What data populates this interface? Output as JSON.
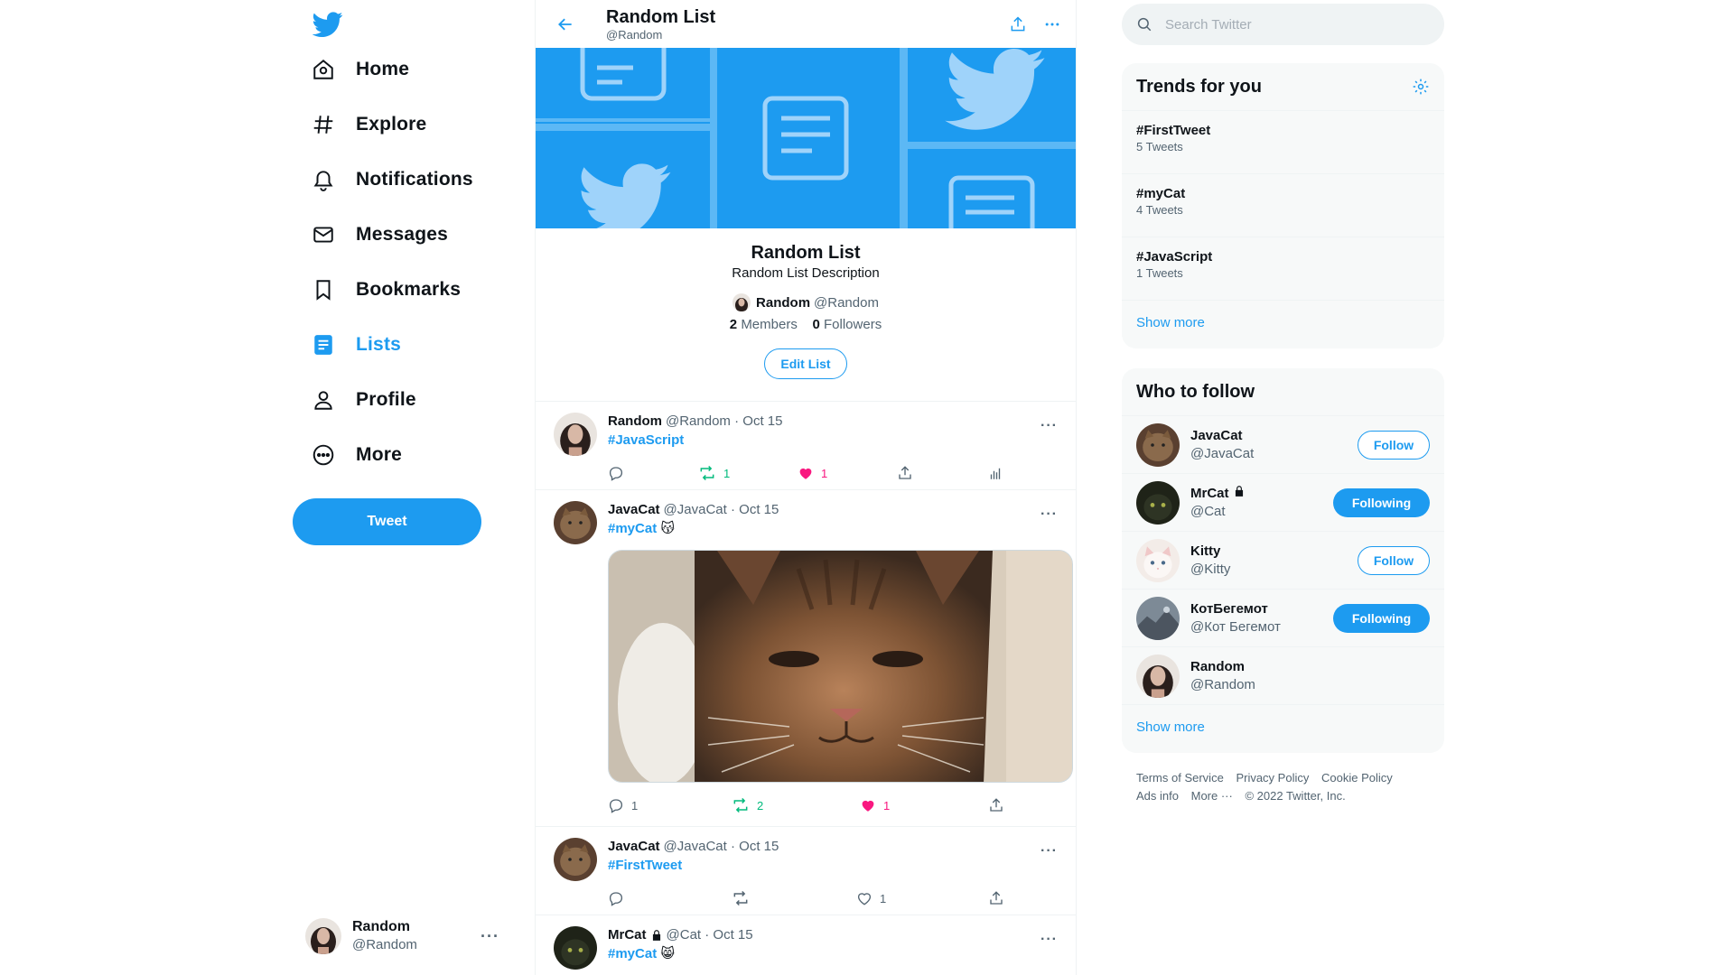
{
  "colors": {
    "accent": "#1d9bf0",
    "like": "#f91880",
    "retweet": "#00ba7c",
    "text": "#0f1419",
    "muted": "#536471"
  },
  "nav": {
    "items": [
      {
        "label": "Home",
        "icon": "home-icon"
      },
      {
        "label": "Explore",
        "icon": "hashtag-icon"
      },
      {
        "label": "Notifications",
        "icon": "bell-icon"
      },
      {
        "label": "Messages",
        "icon": "envelope-icon"
      },
      {
        "label": "Bookmarks",
        "icon": "bookmark-icon"
      },
      {
        "label": "Lists",
        "icon": "list-icon",
        "active": true
      },
      {
        "label": "Profile",
        "icon": "user-icon"
      },
      {
        "label": "More",
        "icon": "more-circle-icon"
      }
    ],
    "tweet_button": "Tweet"
  },
  "account": {
    "name": "Random",
    "handle": "@Random",
    "dots": "···"
  },
  "header": {
    "title": "Random List",
    "handle": "@Random"
  },
  "list": {
    "name": "Random List",
    "description": "Random List Description",
    "owner_name": "Random",
    "owner_handle": "@Random",
    "members_count": "2",
    "members_label": "Members",
    "followers_count": "0",
    "followers_label": "Followers",
    "edit_button": "Edit List"
  },
  "tweets": [
    {
      "name": "Random",
      "handle": "@Random",
      "date": "· Oct 15",
      "hashtag": "#JavaScript",
      "emoji": "",
      "replies": "",
      "retweets": "1",
      "likes": "1",
      "liked": true,
      "retweeted": true,
      "locked": false,
      "has_media": false
    },
    {
      "name": "JavaCat",
      "handle": "@JavaCat",
      "date": "· Oct 15",
      "hashtag": "#myCat",
      "emoji": "😽",
      "replies": "1",
      "retweets": "2",
      "likes": "1",
      "liked": true,
      "retweeted": true,
      "locked": false,
      "has_media": true
    },
    {
      "name": "JavaCat",
      "handle": "@JavaCat",
      "date": "· Oct 15",
      "hashtag": "#FirstTweet",
      "emoji": "",
      "replies": "",
      "retweets": "",
      "likes": "1",
      "liked": false,
      "retweeted": false,
      "locked": false,
      "has_media": false
    },
    {
      "name": "MrCat",
      "handle": "@Cat",
      "date": "· Oct 15",
      "hashtag": "#myCat",
      "emoji": "😸",
      "replies": "",
      "retweets": "",
      "likes": "",
      "liked": false,
      "retweeted": false,
      "locked": true,
      "has_media": false
    }
  ],
  "search": {
    "placeholder": "Search Twitter",
    "value": ""
  },
  "trends": {
    "title": "Trends for you",
    "items": [
      {
        "tag": "#FirstTweet",
        "count": "5 Tweets"
      },
      {
        "tag": "#myCat",
        "count": "4 Tweets"
      },
      {
        "tag": "#JavaScript",
        "count": "1 Tweets"
      }
    ],
    "show_more": "Show more"
  },
  "who_to_follow": {
    "title": "Who to follow",
    "users": [
      {
        "name": "JavaCat",
        "handle": "@JavaCat",
        "button": "Follow",
        "following": false,
        "locked": false
      },
      {
        "name": "MrCat",
        "handle": "@Cat",
        "button": "Following",
        "following": true,
        "locked": true
      },
      {
        "name": "Kitty",
        "handle": "@Kitty",
        "button": "Follow",
        "following": false,
        "locked": false
      },
      {
        "name": "КотБегемот",
        "handle": "@Кот Бегемот",
        "button": "Following",
        "following": true,
        "locked": false
      },
      {
        "name": "Random",
        "handle": "@Random",
        "button": "",
        "following": false,
        "locked": false
      }
    ],
    "show_more": "Show more"
  },
  "footer": {
    "links": [
      "Terms of Service",
      "Privacy Policy",
      "Cookie Policy",
      "Ads info",
      "More ···"
    ],
    "copyright": "© 2022 Twitter, Inc."
  }
}
